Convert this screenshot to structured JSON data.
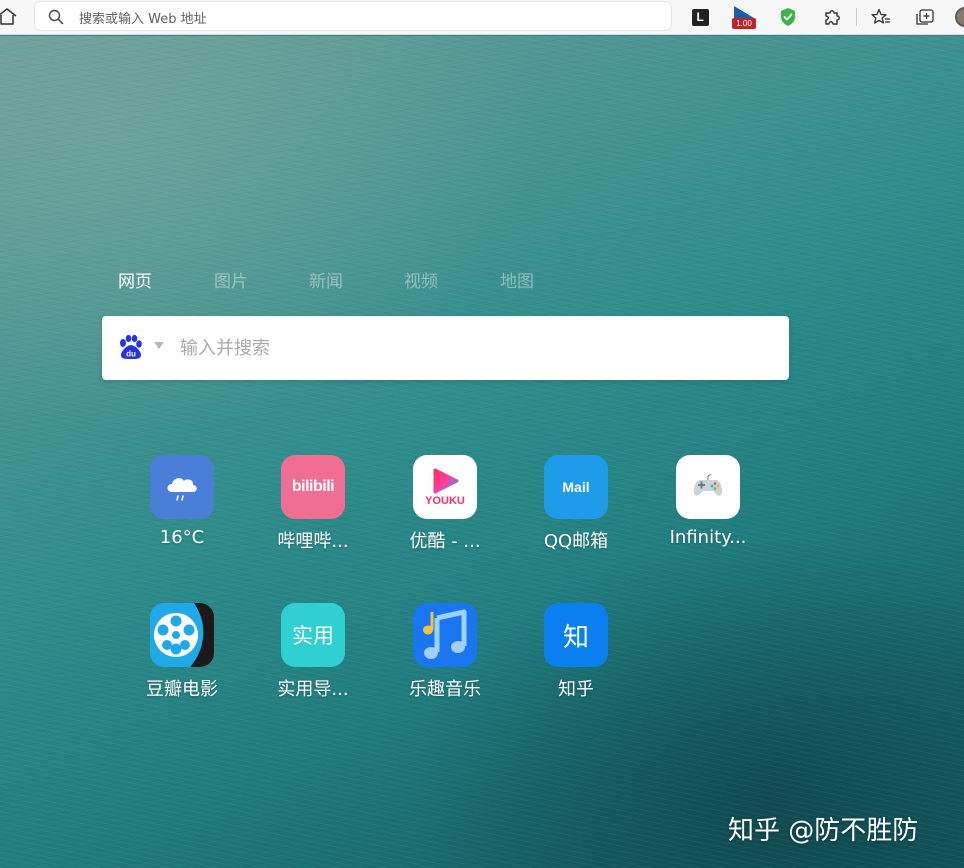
{
  "browser": {
    "address_placeholder": "搜索或输入 Web 地址",
    "speed_badge": "1.00"
  },
  "search": {
    "tabs": [
      "网页",
      "图片",
      "新闻",
      "视频",
      "地图"
    ],
    "active_tab": "网页",
    "placeholder": "输入并搜索",
    "engine": "baidu"
  },
  "shortcuts": [
    {
      "label": "16°C",
      "icon": "weather-cloud-icon",
      "color": "#4a7fd8"
    },
    {
      "label": "哔哩哔...",
      "icon": "bilibili-icon",
      "color": "#f25d8e",
      "tile_text": "bilibili"
    },
    {
      "label": "优酷 - ...",
      "icon": "youku-icon",
      "color": "#ffffff",
      "tile_text": "YOUKU"
    },
    {
      "label": "QQ邮箱",
      "icon": "qq-mail-icon",
      "color": "#1e9be9",
      "tile_text": "Mail"
    },
    {
      "label": "Infinity...",
      "icon": "gamepad-icon",
      "color": "#ffffff"
    },
    {
      "label": "豆瓣电影",
      "icon": "douban-film-icon",
      "color": "#1fa9e6"
    },
    {
      "label": "实用导...",
      "icon": "practical-nav-icon",
      "color": "#30cfd0",
      "tile_text": "实用"
    },
    {
      "label": "乐趣音乐",
      "icon": "music-note-icon",
      "color": "#1877f2"
    },
    {
      "label": "知乎",
      "icon": "zhihu-icon",
      "color": "#0a7ff0",
      "tile_text": "知"
    }
  ],
  "watermark": "知乎 @防不胜防"
}
